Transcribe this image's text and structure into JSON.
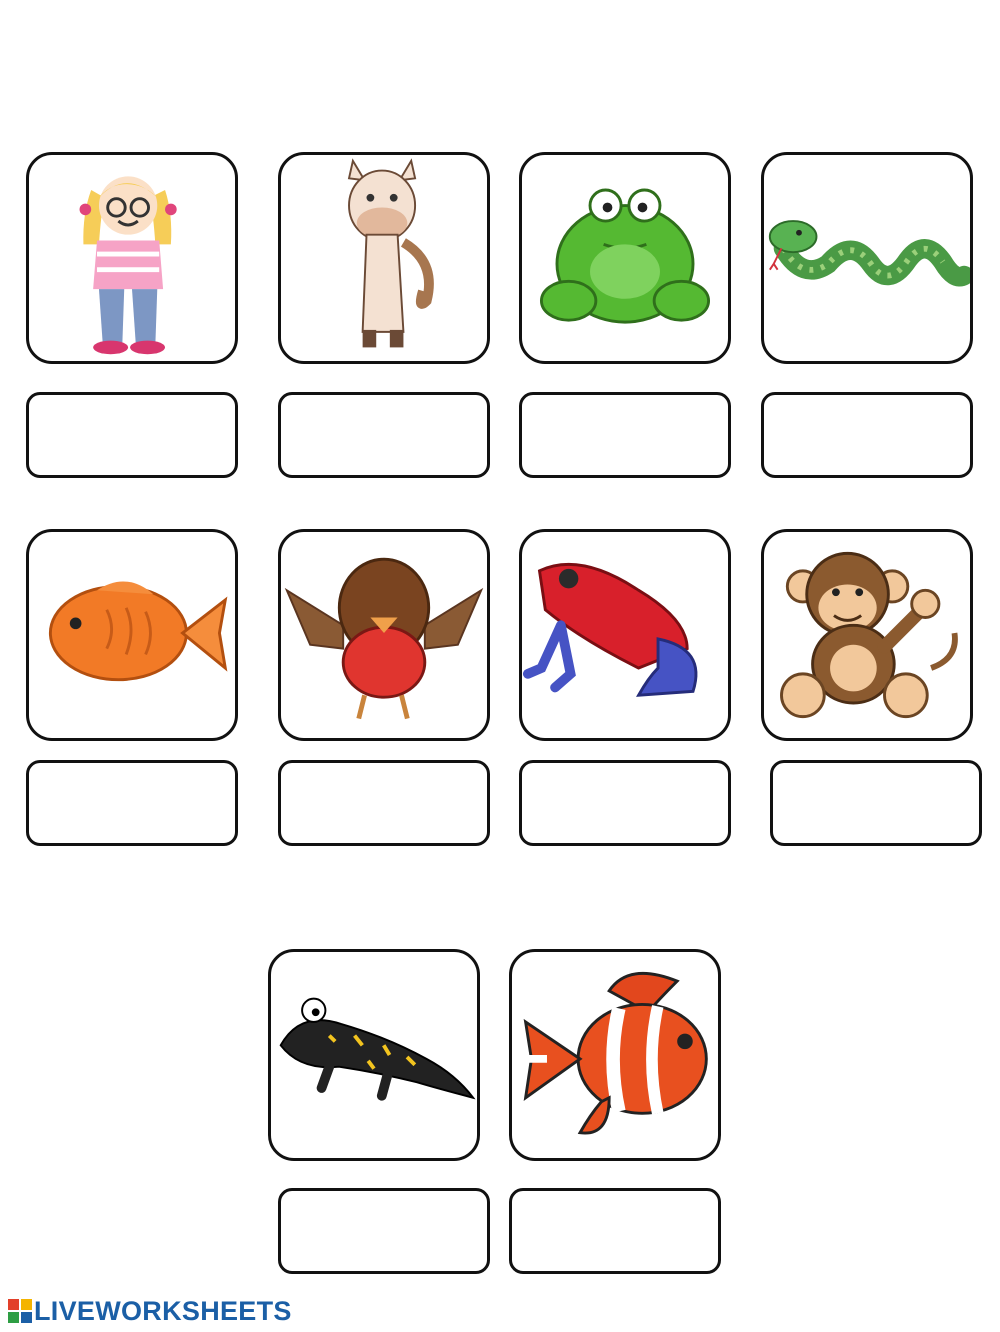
{
  "worksheet": {
    "cards": [
      {
        "picture": "girl-icon",
        "answer_value": ""
      },
      {
        "picture": "horse-icon",
        "answer_value": ""
      },
      {
        "picture": "frog-icon",
        "answer_value": ""
      },
      {
        "picture": "snake-icon",
        "answer_value": ""
      },
      {
        "picture": "fish-icon",
        "answer_value": ""
      },
      {
        "picture": "bird-icon",
        "answer_value": ""
      },
      {
        "picture": "poison-dart-frog-icon",
        "answer_value": ""
      },
      {
        "picture": "monkey-icon",
        "answer_value": ""
      },
      {
        "picture": "salamander-icon",
        "answer_value": ""
      },
      {
        "picture": "clownfish-icon",
        "answer_value": ""
      }
    ]
  },
  "footer": {
    "brand": "LIVEWORKSHEETS",
    "brand_color": "#1b5fa6"
  }
}
